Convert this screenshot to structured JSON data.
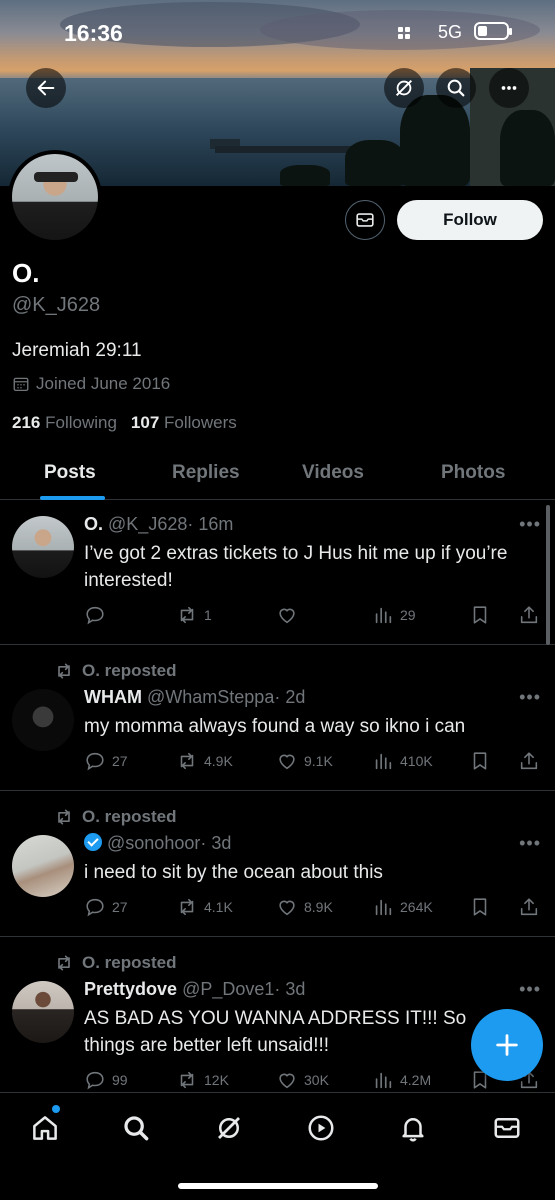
{
  "status_bar": {
    "time": "16:36",
    "network": "5G"
  },
  "profile": {
    "name": "O.",
    "handle": "@K_J628",
    "bio": "Jeremiah 29:11",
    "joined": "Joined June 2016",
    "following_count": "216",
    "following_label": "Following",
    "followers_count": "107",
    "followers_label": "Followers",
    "follow_label": "Follow"
  },
  "tabs": [
    {
      "label": "Posts",
      "active": true
    },
    {
      "label": "Replies",
      "active": false
    },
    {
      "label": "Videos",
      "active": false
    },
    {
      "label": "Photos",
      "active": false
    }
  ],
  "posts": [
    {
      "name": "O.",
      "handle": "@K_J628",
      "time": "· 16m",
      "text": "I’ve got 2 extras tickets to J Hus hit me up if you’re interested!",
      "replies": "",
      "reposts": "1",
      "likes": "",
      "views": "29"
    },
    {
      "repost_label": "O. reposted",
      "name": "WHAM",
      "handle": "@WhamSteppa",
      "time": "· 2d",
      "text": "my momma always found a way so ikno i can",
      "replies": "27",
      "reposts": "4.9K",
      "likes": "9.1K",
      "views": "410K"
    },
    {
      "repost_label": "O. reposted",
      "name": "",
      "handle": "@sonohoor",
      "time": "· 3d",
      "text": "i need to sit by the ocean about this",
      "replies": "27",
      "reposts": "4.1K",
      "likes": "8.9K",
      "views": "264K"
    },
    {
      "repost_label": "O. reposted",
      "name": "Prettydove",
      "handle": "@P_Dove1",
      "time": "· 3d",
      "text_line1": "AS BAD AS YOU WANNA ADDRESS IT!!! So",
      "text_line2": "things are better left unsaid!!!",
      "replies": "99",
      "reposts": "12K",
      "likes": "30K",
      "views": "4.2M"
    }
  ],
  "colors": {
    "accent": "#1d9bf0",
    "muted": "#71767b",
    "background": "#000000"
  }
}
